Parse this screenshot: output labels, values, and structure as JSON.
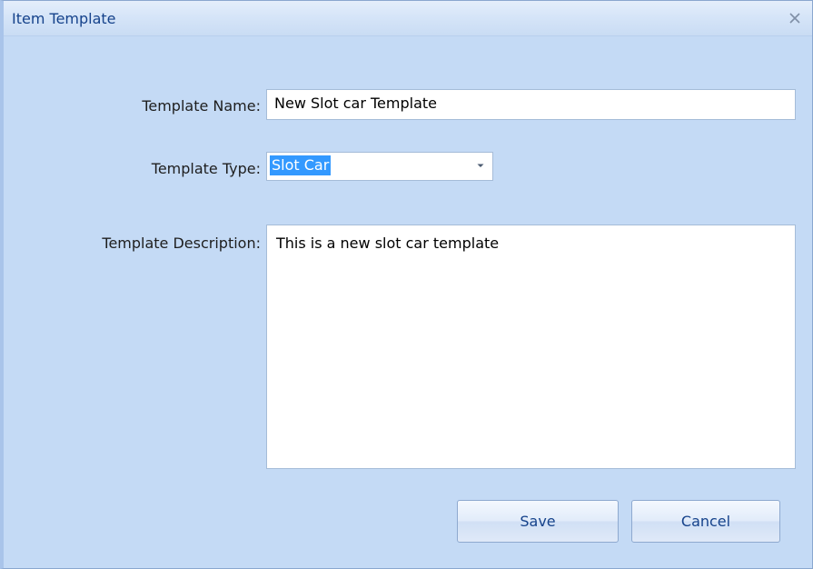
{
  "window": {
    "title": "Item Template"
  },
  "form": {
    "name_label": "Template Name:",
    "name_value": "New Slot car Template",
    "type_label": "Template Type:",
    "type_selected": "Slot Car",
    "description_label": "Template Description:",
    "description_value": "This is a new slot car template"
  },
  "buttons": {
    "save_label": "Save",
    "cancel_label": "Cancel"
  },
  "icons": {
    "close": "close-icon",
    "dropdown": "chevron-down-icon"
  },
  "colors": {
    "background": "#c4daf5",
    "title_text": "#15428b",
    "selection": "#3399ff"
  }
}
